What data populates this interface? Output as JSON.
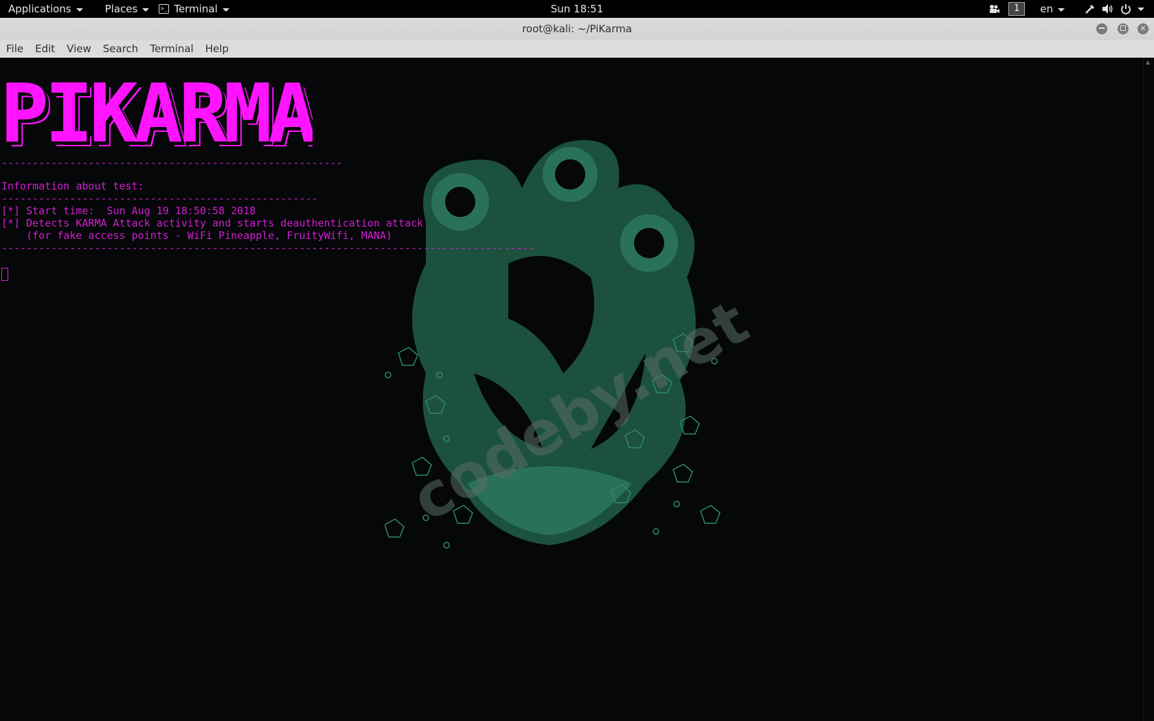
{
  "topbar": {
    "applications": "Applications",
    "places": "Places",
    "terminal_app": "Terminal",
    "clock": "Sun 18:51",
    "workspace": "1",
    "language": "en"
  },
  "window": {
    "title": "root@kali: ~/PiKarma"
  },
  "menu": [
    "File",
    "Edit",
    "View",
    "Search",
    "Terminal",
    "Help"
  ],
  "terminal": {
    "banner": "PIKARMA",
    "lines": [
      "-------------------------------------------------------",
      "Information about test:",
      "---------------------------------------------------",
      "[*] Start time:  Sun Aug 19 18:50:58 2018",
      "[*] Detects KARMA Attack activity and starts deauthentication attack",
      "    (for fake access points - WiFi Pineapple, FruityWifi, MANA)",
      "--------------------------------------------------------------------------------------"
    ],
    "text_color": "#d21fd2"
  },
  "watermark": "codeby.net",
  "icons": {
    "terminal": "terminal-icon",
    "screencast": "camera-icon",
    "network": "network-icon",
    "volume": "volume-icon",
    "power": "power-icon"
  }
}
